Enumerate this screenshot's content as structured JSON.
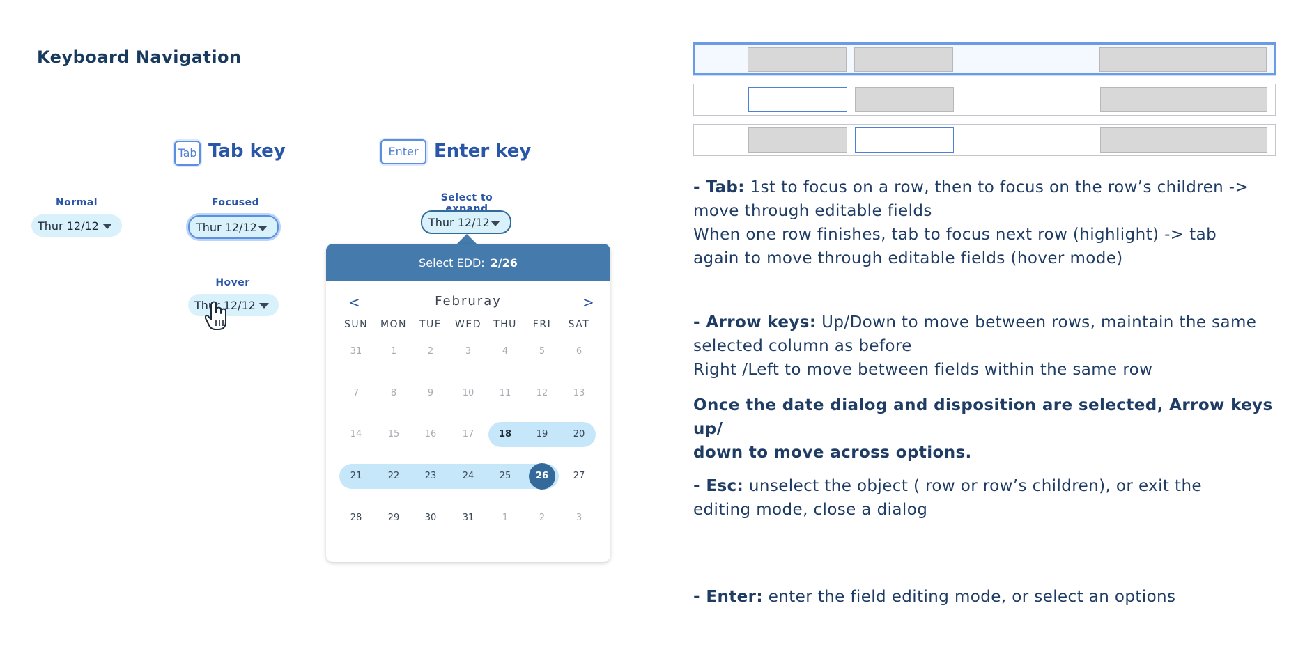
{
  "page_title": "Keyboard Navigation",
  "tab_section": {
    "key_label": "Tab",
    "title": "Tab key"
  },
  "enter_section": {
    "key_label": "Enter",
    "title": "Enter key"
  },
  "states": {
    "normal": {
      "label": "Normal",
      "value": "Thur 12/12"
    },
    "focused": {
      "label": "Focused",
      "value": "Thur 12/12"
    },
    "hover": {
      "label": "Hover",
      "value": "Thur 12/12"
    },
    "expand": {
      "label": "Select to expand",
      "value": "Thur 12/12"
    }
  },
  "calendar": {
    "header_label": "Select EDD:",
    "header_value": "2/26",
    "month": "Februray",
    "prev_label": "<",
    "next_label": ">",
    "weekdays": [
      "SUN",
      "MON",
      "TUE",
      "WED",
      "THU",
      "FRI",
      "SAT"
    ],
    "weeks": [
      [
        "31",
        "1",
        "2",
        "3",
        "4",
        "5",
        "6"
      ],
      [
        "7",
        "8",
        "9",
        "10",
        "11",
        "12",
        "13"
      ],
      [
        "14",
        "15",
        "16",
        "17",
        "18",
        "19",
        "20"
      ],
      [
        "21",
        "22",
        "23",
        "24",
        "25",
        "26",
        "27"
      ],
      [
        "28",
        "29",
        "30",
        "31",
        "1",
        "2",
        "3"
      ]
    ],
    "selected_day": "26",
    "range_start_day": "18"
  },
  "notes": {
    "tab_key": "- Tab:",
    "tab_text_1": "  1st to focus on a row,  then to focus on the row’s children ->",
    "tab_text_2": "move through editable fields",
    "tab_text_3": "When one row finishes, tab to focus next row (highlight) -> tab",
    "tab_text_4": "again to move through editable fields (hover mode)",
    "arrow_key": "- Arrow keys:",
    "arrow_text_1": "   Up/Down to move between rows, maintain the same",
    "arrow_text_2": "selected column as before",
    "arrow_text_3": "Right /Left to move between fields within the same row",
    "arrow_bold_1": "Once the date dialog and disposition are selected,  Arrow keys up/",
    "arrow_bold_2": "down to move across options.",
    "esc_key": "- Esc:",
    "esc_text_1": " unselect the object ( row or row’s children), or exit the",
    "esc_text_2": "editing mode, close a dialog",
    "enter_key": "- Enter:",
    "enter_text": " enter the field editing mode, or select an options"
  }
}
